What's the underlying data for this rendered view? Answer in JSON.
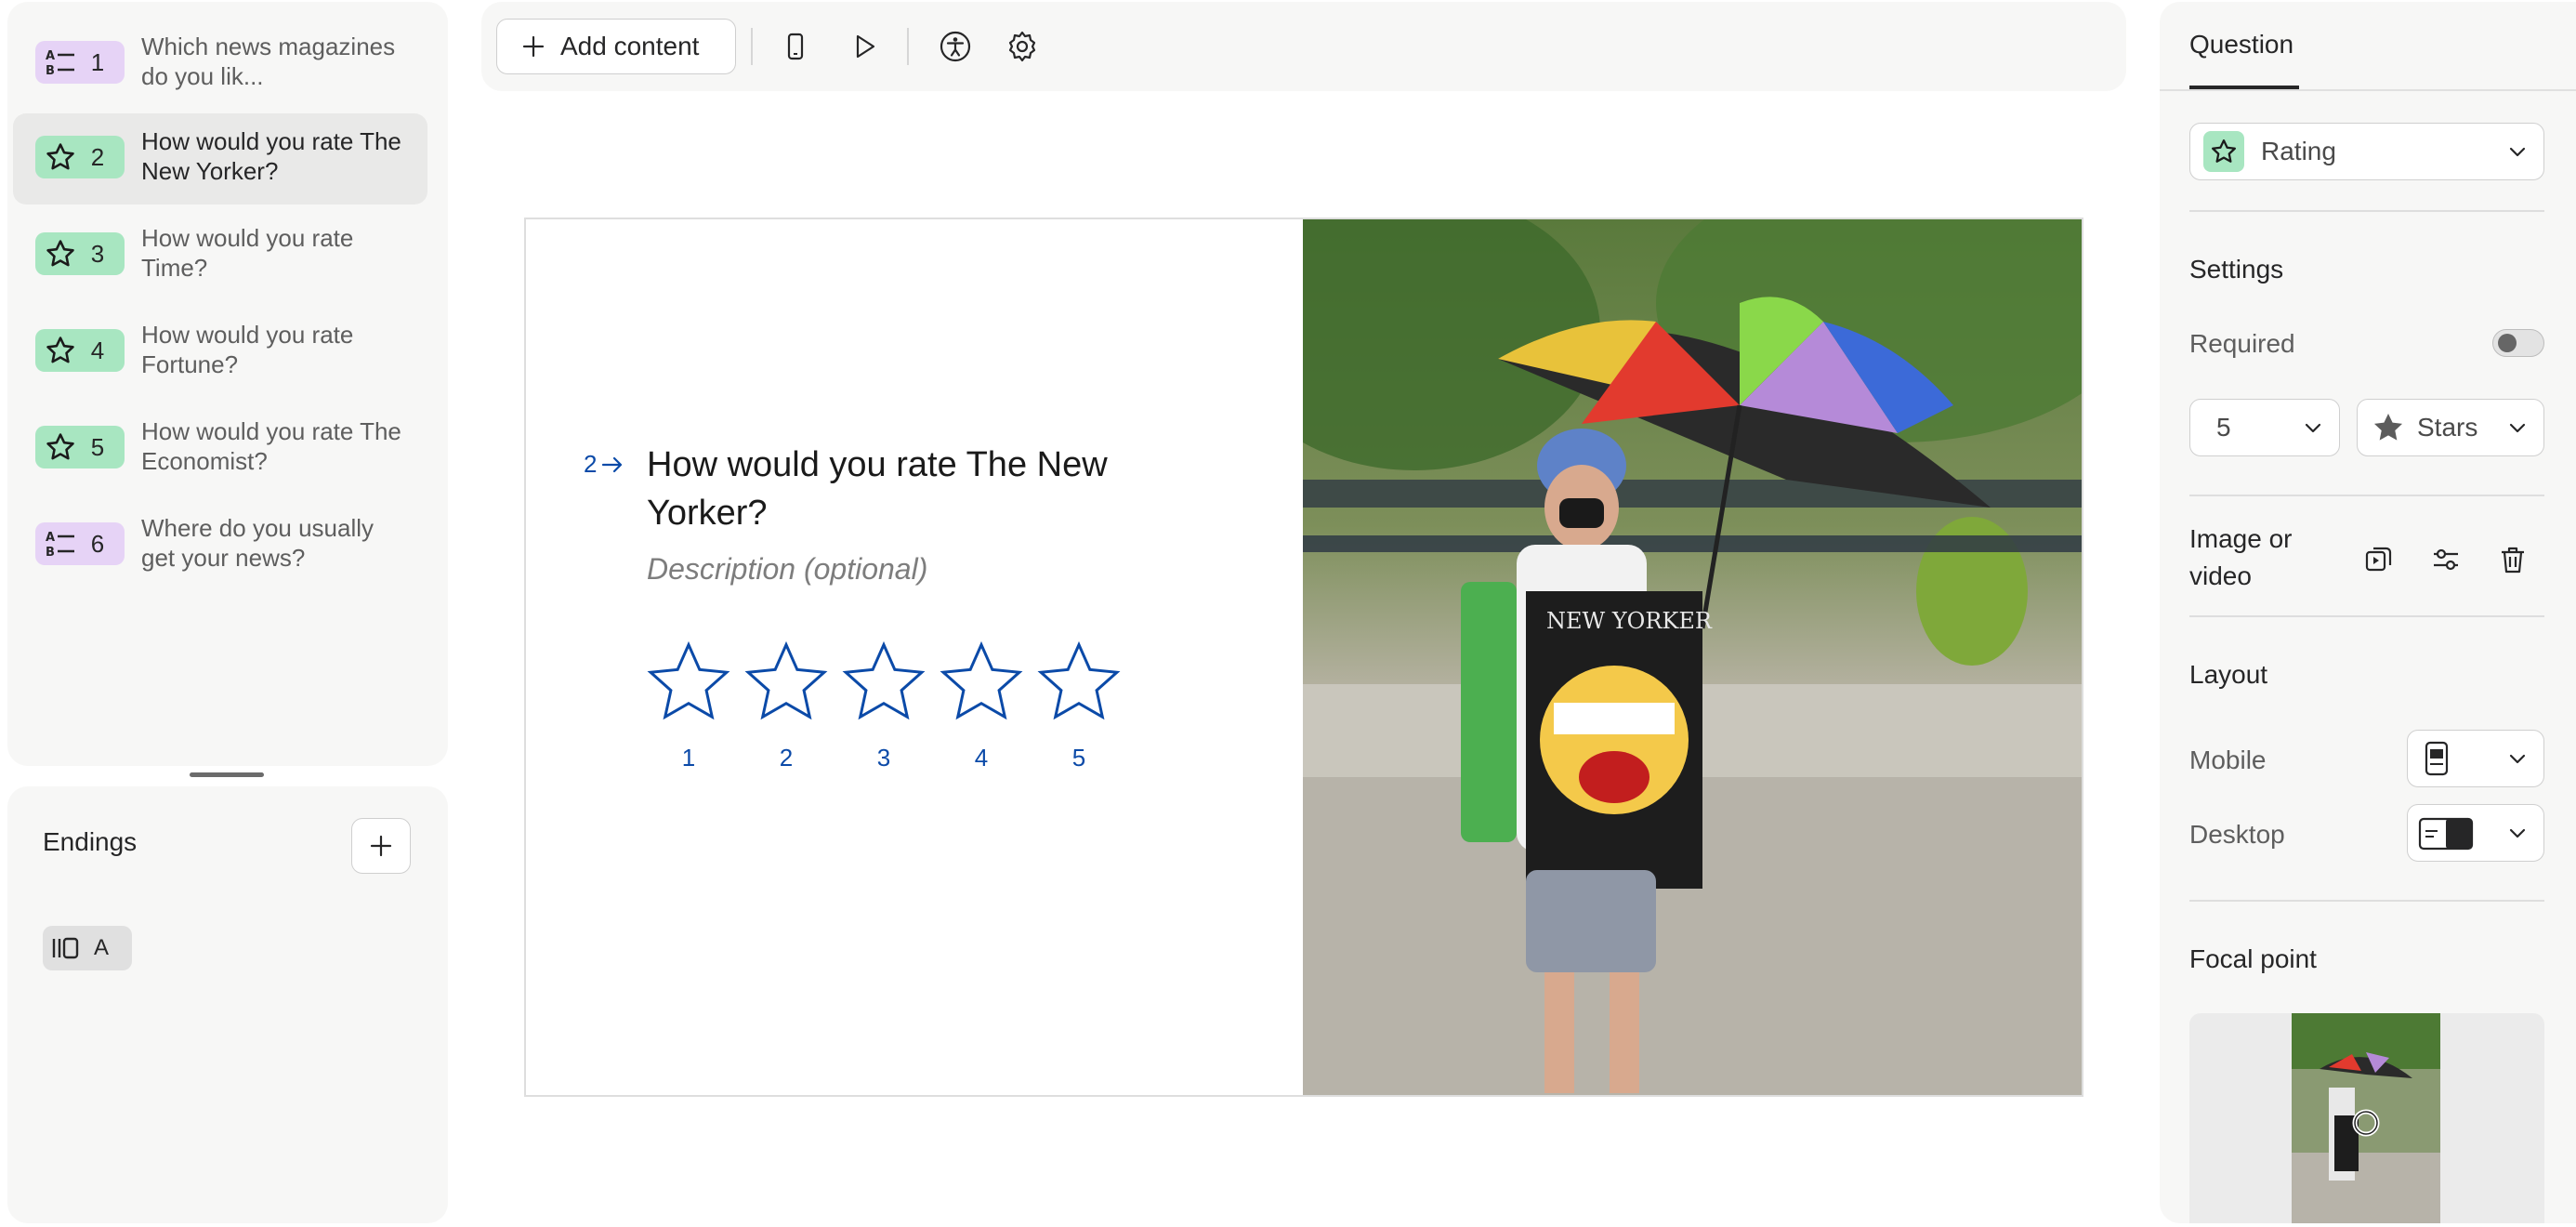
{
  "sidebar": {
    "questions": [
      {
        "number": "1",
        "type": "multiple-choice",
        "text": "Which news magazines do you lik..."
      },
      {
        "number": "2",
        "type": "rating",
        "text": "How would you rate The New Yorker?",
        "active": true
      },
      {
        "number": "3",
        "type": "rating",
        "text": "How would you rate Time?"
      },
      {
        "number": "4",
        "type": "rating",
        "text": "How would you rate Fortune?"
      },
      {
        "number": "5",
        "type": "rating",
        "text": "How would you rate The Economist?"
      },
      {
        "number": "6",
        "type": "multiple-choice",
        "text": "Where do you usually get your news?"
      }
    ],
    "endings": {
      "title": "Endings",
      "items": [
        {
          "label": "A"
        }
      ]
    }
  },
  "toolbar": {
    "add_content_label": "Add content",
    "icons": [
      "mobile-preview-icon",
      "play-icon",
      "accessibility-icon",
      "settings-gear-icon"
    ]
  },
  "canvas": {
    "question_number": "2",
    "question_title": "How would you rate The New Yorker?",
    "description_placeholder": "Description (optional)",
    "rating_labels": [
      "1",
      "2",
      "3",
      "4",
      "5"
    ],
    "star_color": "#0b4aa8"
  },
  "right_panel": {
    "tab": "Question",
    "question_type": "Rating",
    "settings_title": "Settings",
    "required_label": "Required",
    "required_on": false,
    "steps_value": "5",
    "shape_value": "Stars",
    "image_or_video_label": "Image or video",
    "layout_title": "Layout",
    "mobile_label": "Mobile",
    "desktop_label": "Desktop",
    "focal_point_title": "Focal point"
  },
  "colors": {
    "rating_badge": "#a8e6c1",
    "multiple_choice_badge": "#e6d3f6",
    "accent_blue": "#0b4aa8"
  }
}
